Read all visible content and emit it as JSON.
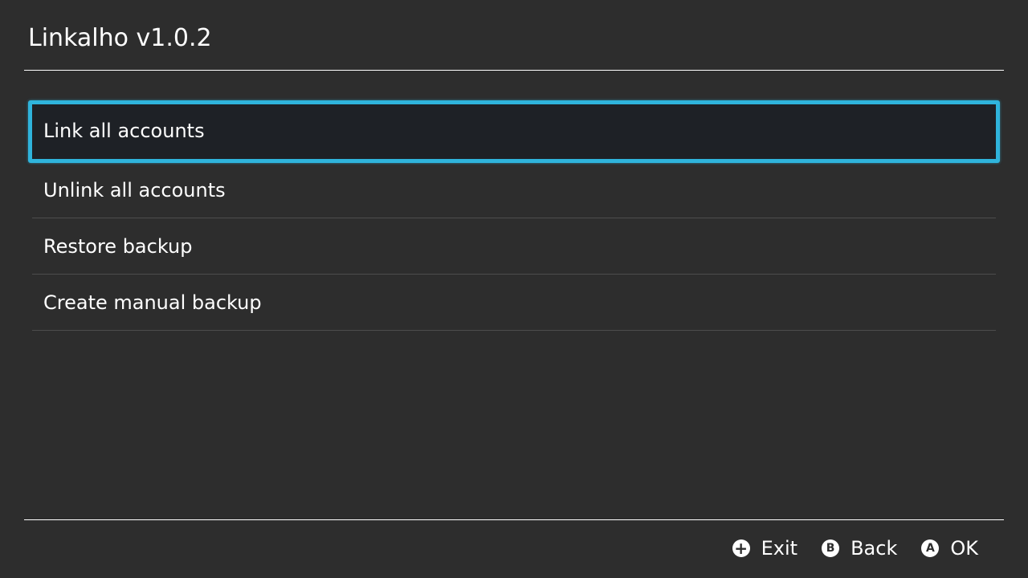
{
  "header": {
    "title": "Linkalho v1.0.2"
  },
  "menu": {
    "items": [
      {
        "label": "Link all accounts",
        "selected": true
      },
      {
        "label": "Unlink all accounts",
        "selected": false
      },
      {
        "label": "Restore backup",
        "selected": false
      },
      {
        "label": "Create manual backup",
        "selected": false
      }
    ]
  },
  "footer": {
    "hints": [
      {
        "icon": "plus-button-icon",
        "glyph": "+",
        "label": "Exit"
      },
      {
        "icon": "b-button-icon",
        "glyph": "B",
        "label": "Back"
      },
      {
        "icon": "a-button-icon",
        "glyph": "A",
        "label": "OK"
      }
    ]
  },
  "colors": {
    "background": "#2d2d2d",
    "selection_border": "#2fb4dc",
    "selection_fill": "#1e2126",
    "text": "#ffffff",
    "divider": "#4d4d4d"
  }
}
